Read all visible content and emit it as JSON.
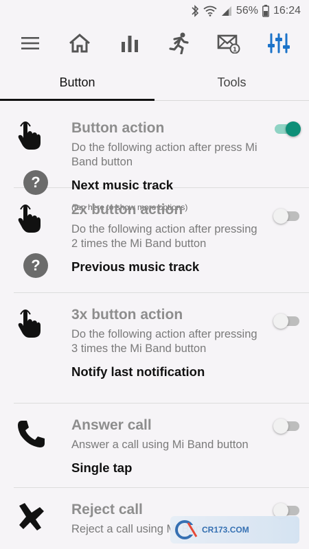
{
  "status_bar": {
    "battery": "56%",
    "time": "16:24"
  },
  "tabs": [
    {
      "label": "Button",
      "active": true
    },
    {
      "label": "Tools",
      "active": false
    }
  ],
  "rows": [
    {
      "title": "Button action",
      "desc": "Do the following action after press Mi Band button",
      "value": "Next music track",
      "hint": "(tap here to show more options)",
      "toggle_on": true
    },
    {
      "title": "2x button action",
      "desc": "Do the following action after pressing 2 times the Mi Band button",
      "value": "Previous music track",
      "toggle_on": false
    },
    {
      "title": "3x button action",
      "desc": "Do the following action after pressing 3 times the Mi Band button",
      "value": "Notify last notification",
      "toggle_on": false
    },
    {
      "title": "Answer call",
      "desc": "Answer a call using Mi Band button",
      "value": "Single tap",
      "toggle_on": false
    },
    {
      "title": "Reject call",
      "desc": "Reject a call using Mi Band",
      "toggle_on": false
    }
  ],
  "watermark": {
    "text": "CR173.COM"
  },
  "colors": {
    "accent": "#0e8f78",
    "tab_selected_icon": "#1c73c9"
  }
}
